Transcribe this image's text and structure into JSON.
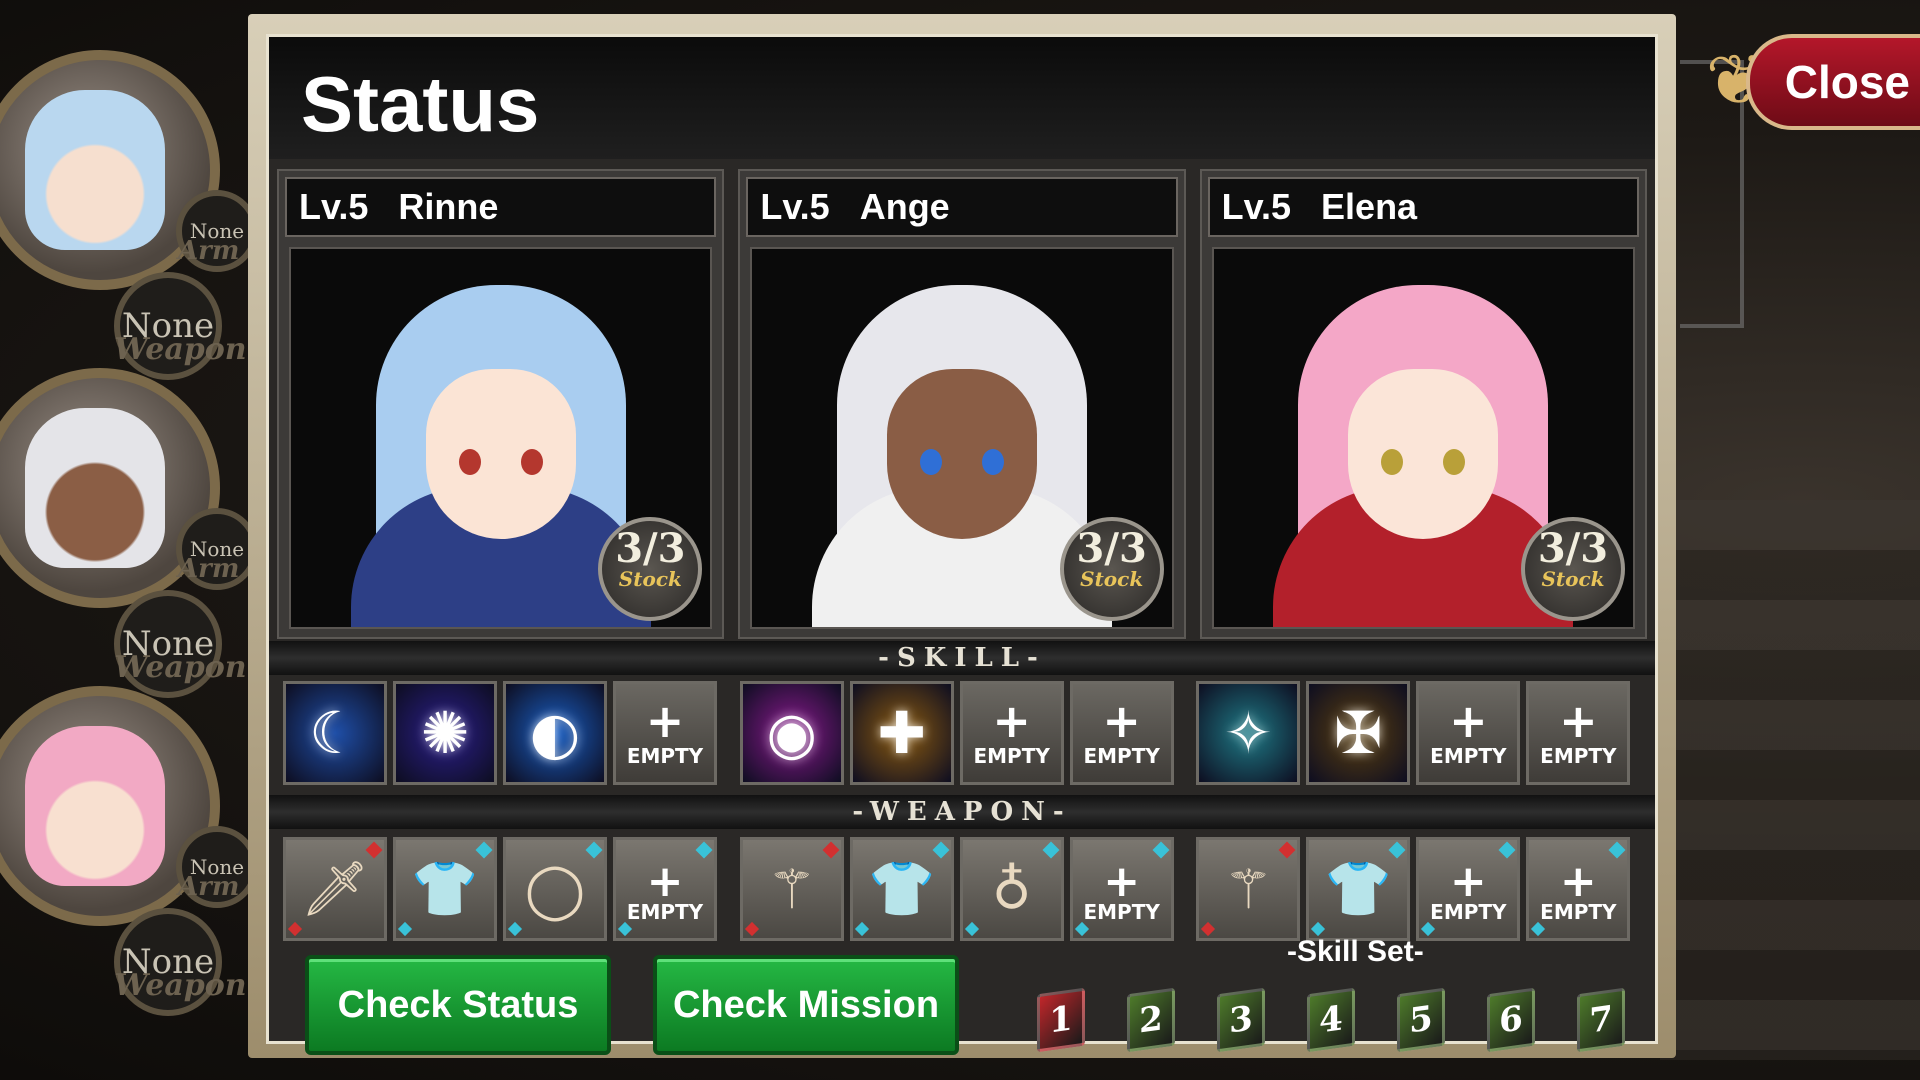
{
  "title": "Status",
  "close_label": "Close",
  "party_sidebar": [
    {
      "armor_slot": "None",
      "armor_caption": "Arm",
      "weapon_slot": "None",
      "weapon_caption": "Weapon",
      "hair": "#b9d7ef",
      "skin": "#f6dfcf"
    },
    {
      "armor_slot": "None",
      "armor_caption": "Arm",
      "weapon_slot": "None",
      "weapon_caption": "Weapon",
      "hair": "#e4e4e8",
      "skin": "#8b5e45"
    },
    {
      "armor_slot": "None",
      "armor_caption": "Arm",
      "weapon_slot": "None",
      "weapon_caption": "Weapon",
      "hair": "#f2a9c4",
      "skin": "#f8e0d0"
    }
  ],
  "characters": [
    {
      "level": "Lv.5",
      "name": "Rinne",
      "stock": "3/3",
      "stock_label": "Stock",
      "hair": "#a9cdf0",
      "skin": "#fbe4d5",
      "eyes": "#b4372e",
      "outfit": "#2d3f86"
    },
    {
      "level": "Lv.5",
      "name": "Ange",
      "stock": "3/3",
      "stock_label": "Stock",
      "hair": "#e7e7ec",
      "skin": "#8a5d45",
      "eyes": "#2f6fd6",
      "outfit": "#f0f0f0"
    },
    {
      "level": "Lv.5",
      "name": "Elena",
      "stock": "3/3",
      "stock_label": "Stock",
      "hair": "#f4a7c7",
      "skin": "#fbe5d8",
      "eyes": "#b9a039",
      "outfit": "#b3202b"
    }
  ],
  "skill_header": "-SKILL-",
  "weapon_header": "-WEAPON-",
  "skills": [
    [
      {
        "empty": false,
        "icon": "crescent-slash-icon",
        "glyph": "☾",
        "bg": "#1f4fa8"
      },
      {
        "empty": false,
        "icon": "burst-aura-icon",
        "glyph": "✺",
        "bg": "#2b1f8a"
      },
      {
        "empty": false,
        "icon": "moon-wave-icon",
        "glyph": "◐",
        "bg": "#1a5fc4"
      },
      {
        "empty": true,
        "label": "EMPTY"
      }
    ],
    [
      {
        "empty": false,
        "icon": "magic-orb-icon",
        "glyph": "◉",
        "bg": "#8a1a8e"
      },
      {
        "empty": false,
        "icon": "holy-tome-icon",
        "glyph": "✚",
        "bg": "#8a5a10"
      },
      {
        "empty": true,
        "label": "EMPTY"
      },
      {
        "empty": true,
        "label": "EMPTY"
      }
    ],
    [
      {
        "empty": false,
        "icon": "water-spirit-icon",
        "glyph": "✧",
        "bg": "#1f7a86"
      },
      {
        "empty": false,
        "icon": "golden-cross-icon",
        "glyph": "✠",
        "bg": "#5a3f10"
      },
      {
        "empty": true,
        "label": "EMPTY"
      },
      {
        "empty": true,
        "label": "EMPTY"
      }
    ]
  ],
  "weapons": [
    [
      {
        "empty": false,
        "icon": "sword-icon",
        "glyph": "🗡",
        "gem": "#d23030"
      },
      {
        "empty": false,
        "icon": "tunic-icon",
        "glyph": "👕",
        "gem": "#39c2d8"
      },
      {
        "empty": false,
        "icon": "ring-icon",
        "glyph": "◯",
        "gem": "#39c2d8"
      },
      {
        "empty": true,
        "label": "EMPTY",
        "gem": "#39c2d8"
      }
    ],
    [
      {
        "empty": false,
        "icon": "staff-icon",
        "glyph": "⚚",
        "gem": "#d23030"
      },
      {
        "empty": false,
        "icon": "tunic-icon",
        "glyph": "👕",
        "gem": "#39c2d8"
      },
      {
        "empty": false,
        "icon": "amulet-icon",
        "glyph": "♁",
        "gem": "#39c2d8"
      },
      {
        "empty": true,
        "label": "EMPTY",
        "gem": "#39c2d8"
      }
    ],
    [
      {
        "empty": false,
        "icon": "staff-icon",
        "glyph": "⚚",
        "gem": "#d23030"
      },
      {
        "empty": false,
        "icon": "tunic-icon",
        "glyph": "👕",
        "gem": "#39c2d8"
      },
      {
        "empty": true,
        "label": "EMPTY",
        "gem": "#39c2d8"
      },
      {
        "empty": true,
        "label": "EMPTY",
        "gem": "#39c2d8"
      }
    ]
  ],
  "buttons": {
    "check_status": "Check Status",
    "check_mission": "Check Mission"
  },
  "skill_set": {
    "title": "-Skill Set-",
    "books": [
      {
        "num": "1",
        "color": "#c0262a"
      },
      {
        "num": "2",
        "color": "#4d7a2a"
      },
      {
        "num": "3",
        "color": "#4d7a2a"
      },
      {
        "num": "4",
        "color": "#4d7a2a"
      },
      {
        "num": "5",
        "color": "#4d7a2a"
      },
      {
        "num": "6",
        "color": "#4d7a2a"
      },
      {
        "num": "7",
        "color": "#4d7a2a"
      }
    ]
  }
}
